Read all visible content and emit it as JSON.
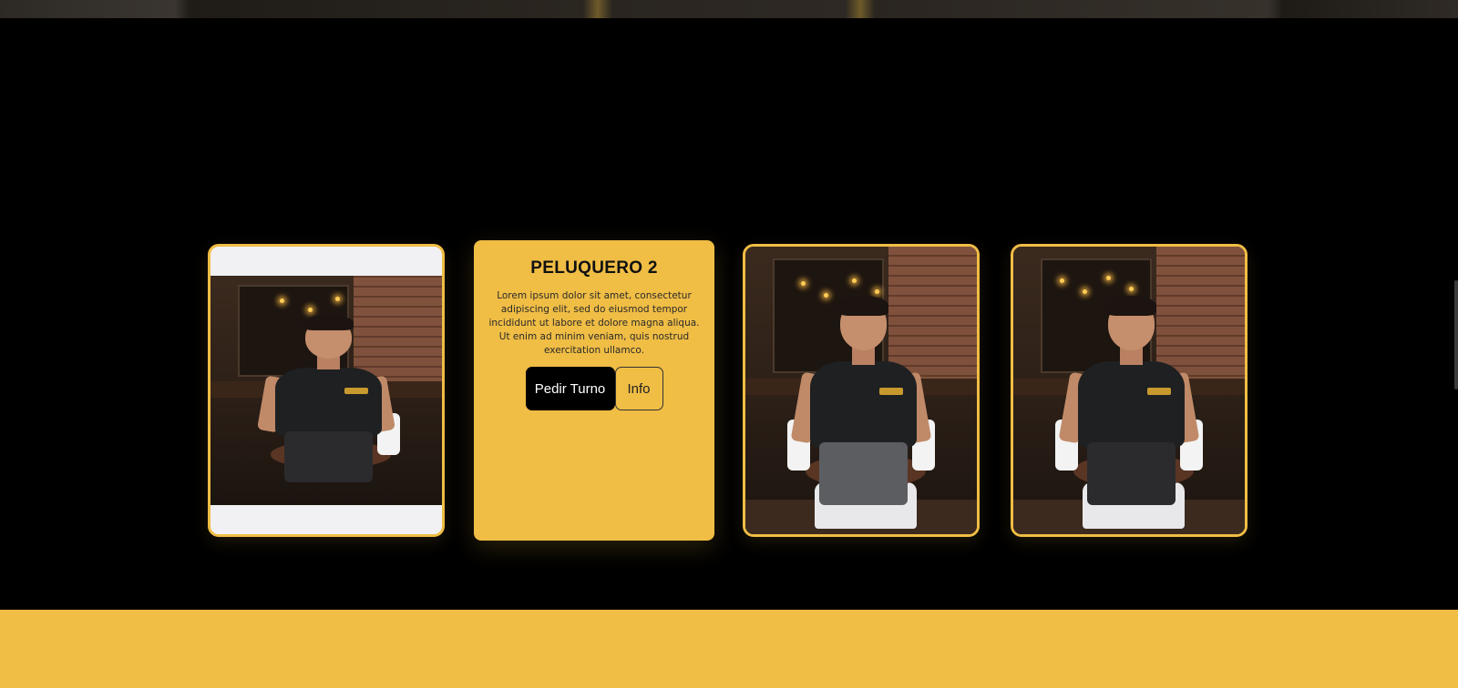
{
  "barbers_section": {
    "featured_card": {
      "title": "PELUQUERO 2",
      "description": "Lorem ipsum dolor sit amet, consectetur adipiscing elit, sed do eiusmod tempor incididunt ut labore et dolore magna aliqua. Ut enim ad minim veniam, quis nostrud exercitation ullamco.",
      "primary_button": "Pedir Turno",
      "secondary_button": "Info"
    },
    "photos": [
      {
        "name": "barber-photo-1",
        "icon": "barber-portrait"
      },
      {
        "name": "barber-photo-3",
        "icon": "barber-portrait"
      },
      {
        "name": "barber-photo-4",
        "icon": "barber-portrait"
      }
    ]
  },
  "colors": {
    "accent": "#f0bd45",
    "background": "#000000",
    "button_primary_bg": "#000000",
    "button_primary_text": "#ffffff"
  }
}
